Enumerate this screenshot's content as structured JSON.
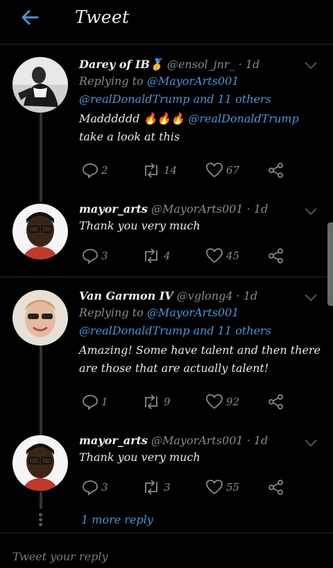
{
  "header": {
    "title": "Tweet"
  },
  "tweets": [
    {
      "name": "Darey of IB",
      "badge": "🥇",
      "handle": "@ensol_jnr_",
      "time": "1d",
      "reply_prefix": "Replying to",
      "reply_user": "@MayorArts001",
      "reply_user2": "@realDonaldTrump",
      "reply_and": "and 11 others",
      "text_a": "Madddddd 🔥🔥🔥",
      "text_mention": "@realDonaldTrump",
      "text_b": "take a look at this",
      "replies": "2",
      "retweets": "14",
      "likes": "67"
    },
    {
      "name": "mayor_arts",
      "handle": "@MayorArts001",
      "time": "1d",
      "text": "Thank you very much",
      "replies": "3",
      "retweets": "4",
      "likes": "45"
    },
    {
      "name": "Van Garmon IV",
      "handle": "@vglong4",
      "time": "1d",
      "reply_prefix": "Replying to",
      "reply_user": "@MayorArts001",
      "reply_user2": "@realDonaldTrump",
      "reply_and": "and 11 others",
      "text": "Amazing! Some have talent and then there are those that are actually talent!",
      "replies": "1",
      "retweets": "9",
      "likes": "92"
    },
    {
      "name": "mayor_arts",
      "handle": "@MayorArts001",
      "time": "1d",
      "text": "Thank you very much",
      "replies": "3",
      "retweets": "3",
      "likes": "55"
    }
  ],
  "more_replies": "1 more reply",
  "reply_input": {
    "placeholder": "Tweet your reply"
  },
  "colors": {
    "accent": "#4a95d6",
    "background": "#000000",
    "muted": "#8a8a8a"
  }
}
